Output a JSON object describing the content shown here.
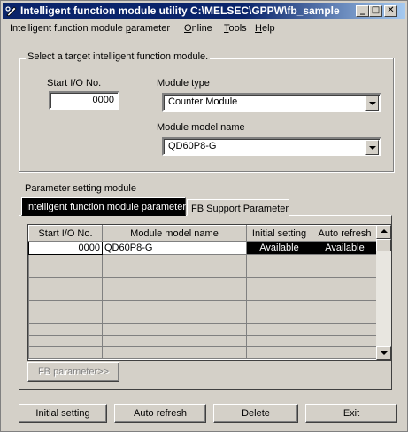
{
  "window": {
    "title": "Intelligent function module utility C:\\MELSEC\\GPPW\\fb_sample",
    "controls": {
      "minimize": "_",
      "maximize": "□",
      "close": "✕"
    }
  },
  "menu": [
    {
      "pre": "Intelligent function module ",
      "ul": "p",
      "post": "arameter"
    },
    {
      "pre": "",
      "ul": "O",
      "post": "nline"
    },
    {
      "pre": "",
      "ul": "T",
      "post": "ools"
    },
    {
      "pre": "",
      "ul": "H",
      "post": "elp"
    }
  ],
  "target_group": {
    "label": "Select a target intelligent function module.",
    "start_io_label": "Start I/O No.",
    "start_io_value": "0000",
    "module_type_label": "Module type",
    "module_type_value": "Counter Module",
    "module_model_label": "Module model name",
    "module_model_value": "QD60P8-G"
  },
  "parameter_section": {
    "label": "Parameter setting module",
    "tabs": [
      "Intelligent function module parameter",
      "FB Support Parameter"
    ]
  },
  "grid": {
    "columns": [
      "Start I/O No.",
      "Module model name",
      "Initial setting",
      "Auto refresh"
    ],
    "rows": [
      [
        "0000",
        "QD60P8-G",
        "Available",
        "Available"
      ]
    ],
    "empty_rows": 9
  },
  "buttons": {
    "fb_parameter": "FB parameter>>",
    "initial_setting": "Initial setting",
    "auto_refresh": "Auto refresh",
    "delete": "Delete",
    "exit": "Exit"
  }
}
